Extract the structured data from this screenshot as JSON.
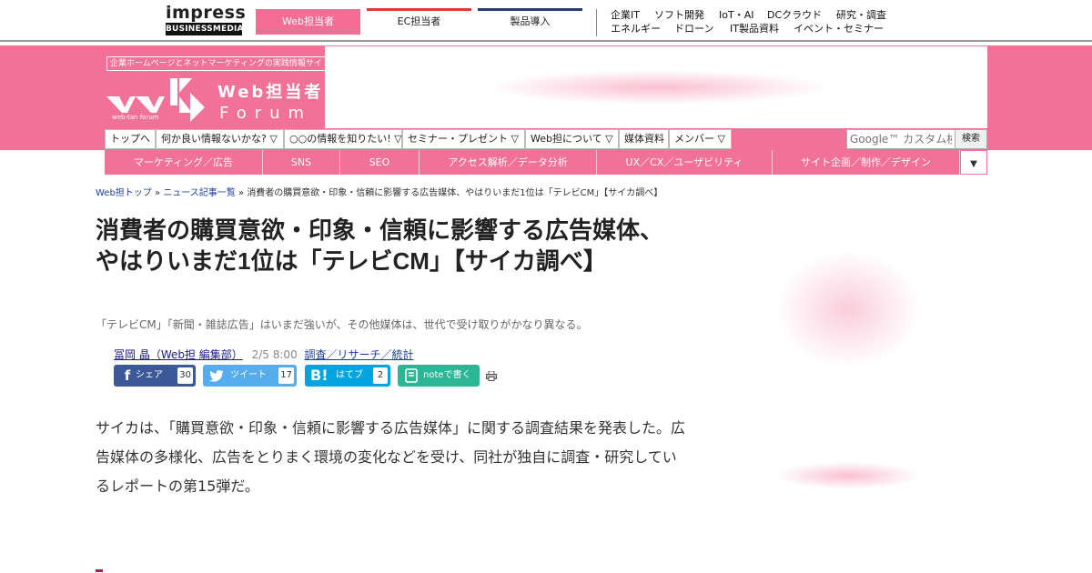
{
  "topbar": {
    "brand": {
      "name": "impress",
      "sub": "BUSINESSMEDIA"
    },
    "site_tabs": [
      {
        "label": "Web担当者",
        "active": true,
        "color": "#f36d94"
      },
      {
        "label": "EC担当者",
        "active": false,
        "color": "#d9402b"
      },
      {
        "label": "製品導入",
        "active": false,
        "color": "#2b3a7a"
      }
    ],
    "categories_row1": [
      "企業IT",
      "ソフト開発",
      "IoT・AI",
      "DCクラウド",
      "研究・調査"
    ],
    "categories_row2": [
      "エネルギー",
      "ドローン",
      "IT製品資料",
      "イベント・セミナー"
    ]
  },
  "logo": {
    "tagline": "企業ホームページとネットマーケティングの実践情報サイト",
    "name_jp": "Web担当者",
    "name_en": "Forum",
    "small": "web-tan forum"
  },
  "nav": {
    "items": [
      "トップへ",
      "何か良い情報ないかな? ▽",
      "○○の情報を知りたい! ▽",
      "セミナー・プレゼント ▽",
      "Web担について ▽",
      "媒体資料",
      "メンバー ▽"
    ],
    "search_placeholder": "Google™ カスタム検索",
    "search_button": "検索"
  },
  "categories": [
    "マーケティング／広告",
    "SNS",
    "SEO",
    "アクセス解析／データ分析",
    "UX／CX／ユーザビリティ",
    "サイト企画／制作／デザイン"
  ],
  "more_icon": "▼",
  "breadcrumb": {
    "home": "Web担トップ",
    "sep": "»",
    "section": "ニュース記事一覧",
    "current": "消費者の購買意欲・印象・信頼に影響する広告媒体、やはりいまだ1位は「テレビCM」【サイカ調べ】"
  },
  "article": {
    "title": "消費者の購買意欲・印象・信頼に影響する広告媒体、やはりいまだ1位は「テレビCM」【サイカ調べ】",
    "subtitle": "「テレビCM」「新聞・雑誌広告」はいまだ強いが、その他媒体は、世代で受け取りがかなり異なる。",
    "author": "冨岡 晶（Web担 編集部）",
    "date": "2/5 8:00",
    "category": "調査／リサーチ／統計",
    "lead": "サイカは、「購買意欲・印象・信頼に影響する広告媒体」に関する調査結果を発表した。広告媒体の多様化、広告をとりまく環境の変化などを受け、同社が独自に調査・研究しているレポートの第15弾だ。"
  },
  "share": {
    "facebook": {
      "label": "シェア",
      "count": "30",
      "color": "#3b5998",
      "icon": "facebook-icon"
    },
    "twitter": {
      "label": "ツイート",
      "count": "17",
      "color": "#55acee",
      "icon": "twitter-icon"
    },
    "hatena": {
      "label": "はてブ",
      "count": "2",
      "color": "#00a4de",
      "icon": "hatena-icon"
    },
    "note": {
      "label": "noteで書く",
      "color": "#2cb696",
      "icon": "note-icon"
    }
  },
  "colors": {
    "brand_pink": "#f27198",
    "link": "#1a3ea6"
  }
}
